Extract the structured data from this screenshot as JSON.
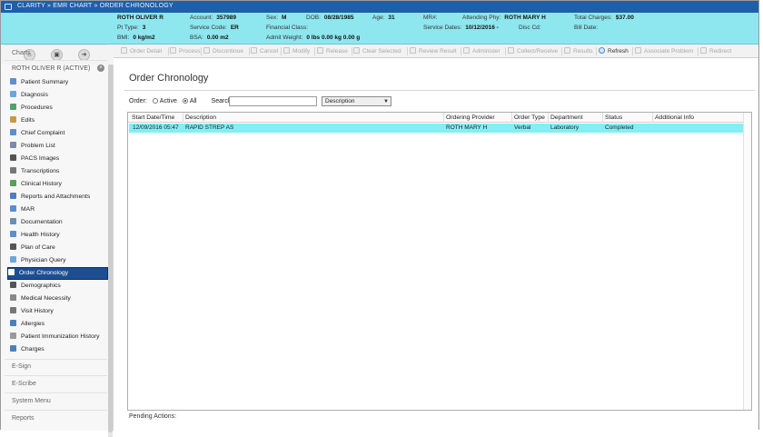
{
  "window": {
    "title": "CLARITY  »  EMR CHART  »  ORDER CHRONOLOGY"
  },
  "banner": {
    "patient_name": "ROTH OLIVER R",
    "pt_type_label": "Pt Type:",
    "pt_type": "3",
    "bmi_label": "BMI:",
    "bmi": "0 kg/m2",
    "account_label": "Account:",
    "account": "357989",
    "service_code_label": "Service Code:",
    "service_code": "ER",
    "bsa_label": "BSA:",
    "bsa": "0.00 m2",
    "sex_label": "Sex:",
    "sex": "M",
    "dob_label": "DOB:",
    "dob": "08/28/1985",
    "age_label": "Age:",
    "age": "31",
    "financial_class_label": "Financial Class:",
    "admit_weight_label": "Admit Weight:",
    "admit_weight": "0 lbs 0.00 kg 0.00 g",
    "mrn_label": "MR#:",
    "service_dates_label": "Service Dates:",
    "service_dates": "10/12/2016 -",
    "attending_label": "Attending Phy:",
    "attending": "ROTH MARY H",
    "disc_cd_label": "Disc Cd:",
    "total_charges_label": "Total Charges:",
    "total_charges": "$37.00",
    "bill_date_label": "Bill Date:"
  },
  "toolbar": {
    "order_detail": "Order Detail",
    "process": "Process",
    "discontinue": "Discontinue",
    "cancel": "Cancel",
    "modify": "Modify",
    "release": "Release",
    "clear_selected": "Clear Selected",
    "review_result": "Review Result",
    "administer": "Administer",
    "collect_receive": "Collect/Receive",
    "results": "Results",
    "refresh": "Refresh",
    "associate_problem": "Associate Problem",
    "redirect": "Redirect"
  },
  "sidebar": {
    "charts": "Charts",
    "patient_header": "ROTH OLIVER R (ACTIVE)",
    "items": [
      {
        "label": "Patient Summary",
        "color": "#5b8fd1"
      },
      {
        "label": "Diagnosis",
        "color": "#6aa7e0"
      },
      {
        "label": "Procedures",
        "color": "#4da36a"
      },
      {
        "label": "Edits",
        "color": "#c99a3c"
      },
      {
        "label": "Chief Complaint",
        "color": "#5b8fd1"
      },
      {
        "label": "Problem List",
        "color": "#7b8bb0"
      },
      {
        "label": "PACS Images",
        "color": "#555555"
      },
      {
        "label": "Transcriptions",
        "color": "#777777"
      },
      {
        "label": "Clinical History",
        "color": "#5a9e5a"
      },
      {
        "label": "Reports and Attachments",
        "color": "#4a7fc1"
      },
      {
        "label": "MAR",
        "color": "#5b8fd1"
      },
      {
        "label": "Documentation",
        "color": "#6a8fb3"
      },
      {
        "label": "Health History",
        "color": "#5b8fd1"
      },
      {
        "label": "Plan of Care",
        "color": "#555555"
      },
      {
        "label": "Physician Query",
        "color": "#6aa7e0"
      },
      {
        "label": "Order Chronology",
        "color": "#ffffff"
      },
      {
        "label": "Demographics",
        "color": "#555555"
      },
      {
        "label": "Medical Necessity",
        "color": "#888888"
      },
      {
        "label": "Visit History",
        "color": "#777777"
      },
      {
        "label": "Allergies",
        "color": "#4a7fc1"
      },
      {
        "label": "Patient Immunization History",
        "color": "#9a9a9a"
      },
      {
        "label": "Charges",
        "color": "#4a7fc1"
      }
    ],
    "e_sign": "E-Sign",
    "e_scribe": "E-Scribe",
    "system_menu": "System Menu",
    "reports": "Reports"
  },
  "main": {
    "title": "Order Chronology",
    "order_label": "Order:",
    "active_label": "Active",
    "all_label": "All",
    "search_label": "Search:",
    "search_value": "",
    "search_field_selected": "Description",
    "columns": [
      "Start Date/Time",
      "Description",
      "Ordering Provider",
      "Order Type",
      "Department",
      "Status",
      "Additional Info"
    ],
    "rows": [
      [
        "12/09/2016 05:47",
        "RAPID STREP AS",
        "ROTH MARY H",
        "Verbal",
        "Laboratory",
        "Completed",
        ""
      ]
    ],
    "pending_actions_label": "Pending Actions:"
  }
}
